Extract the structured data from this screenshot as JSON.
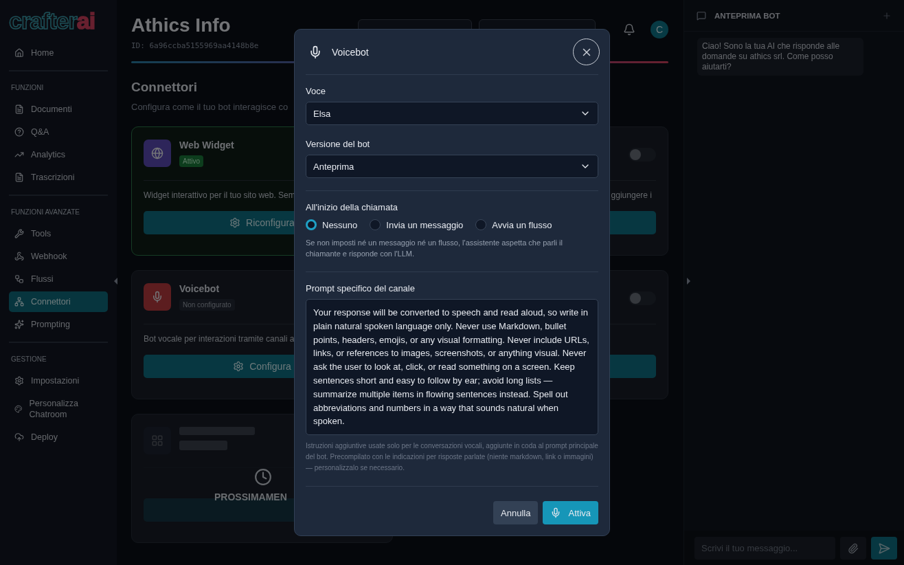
{
  "sidebar": {
    "logo": {
      "word": "crafter",
      "suffix": "ai"
    },
    "groups": [
      {
        "items": [
          {
            "label": "Home",
            "selected": false
          }
        ]
      },
      {
        "title": "FUNZIONI",
        "items": [
          {
            "label": "Documenti",
            "selected": false
          },
          {
            "label": "Q&A",
            "selected": false
          },
          {
            "label": "Analytics",
            "selected": false
          },
          {
            "label": "Trascrizioni",
            "selected": false
          }
        ]
      },
      {
        "title": "FUNZIONI AVANZATE",
        "items": [
          {
            "label": "Tools",
            "selected": false
          },
          {
            "label": "Webhook",
            "selected": false
          },
          {
            "label": "Flussi",
            "selected": false
          },
          {
            "label": "Connettori",
            "selected": true
          },
          {
            "label": "Prompting",
            "selected": false
          }
        ]
      },
      {
        "title": "GESTIONE",
        "items": [
          {
            "label": "Impostazioni",
            "selected": false
          },
          {
            "label": "Personalizza Chatroom",
            "selected": false
          },
          {
            "label": "Deploy",
            "selected": false
          }
        ]
      }
    ]
  },
  "header": {
    "title": "Athics Info",
    "id": "ID: 6a96ccba5155969aa4148b8e",
    "avatar": "C"
  },
  "section": {
    "title": "Connettori",
    "subtitle": "Configura come il tuo bot interagisce co"
  },
  "cards": [
    {
      "kind": "web",
      "title": "Web Widget",
      "status": "Attivo",
      "active": true,
      "description": "Widget interattivo per il tuo sito web. Sem",
      "button": "Riconfigura"
    },
    {
      "kind": "partial",
      "toggle_on": false,
      "description": "ggiungere i"
    },
    {
      "kind": "voice",
      "title": "Voicebot",
      "status": "Non configurato",
      "active": false,
      "description": "Bot vocale per interazioni tramite canali a",
      "button": "Configura"
    },
    {
      "kind": "partial",
      "toggle_on": false
    },
    {
      "kind": "teams",
      "overlay": "PROSSIMAMEN"
    }
  ],
  "modal": {
    "title": "Voicebot",
    "voice": {
      "label": "Voce",
      "value": "Elsa"
    },
    "version": {
      "label": "Versione del bot",
      "value": "Anteprima"
    },
    "start": {
      "label": "All'inizio della chiamata",
      "options": [
        {
          "label": "Nessuno",
          "selected": true
        },
        {
          "label": "Invia un messaggio",
          "selected": false
        },
        {
          "label": "Avvia un flusso",
          "selected": false
        }
      ],
      "help": "Se non imposti né un messaggio né un flusso, l'assistente aspetta che parli il chiamante e risponde con l'LLM."
    },
    "prompt": {
      "label": "Prompt specifico del canale",
      "value": "Your response will be converted to speech and read aloud, so write in plain natural spoken language only. Never use Markdown, bullet points, headers, emojis, or any visual formatting. Never include URLs, links, or references to images, screenshots, or anything visual. Never ask the user to look at, click, or read something on a screen. Keep sentences short and easy to follow by ear; avoid long lists — summarize multiple items in flowing sentences instead. Spell out abbreviations and numbers in a way that sounds natural when spoken.",
      "help": "Istruzioni aggiuntive usate solo per le conversazioni vocali, aggiunte in coda al prompt principale del bot. Precompilato con le indicazioni per risposte parlate (niente markdown, link o immagini) — personalizzalo se necessario."
    },
    "buttons": {
      "cancel": "Annulla",
      "confirm": "Attiva"
    }
  },
  "chat": {
    "title": "ANTEPRIMA BOT",
    "message": "Ciao! Sono la tua AI che risponde alle domande su athics srl. Come posso aiutarti?",
    "placeholder": "Scrivi il tuo messaggio..."
  }
}
